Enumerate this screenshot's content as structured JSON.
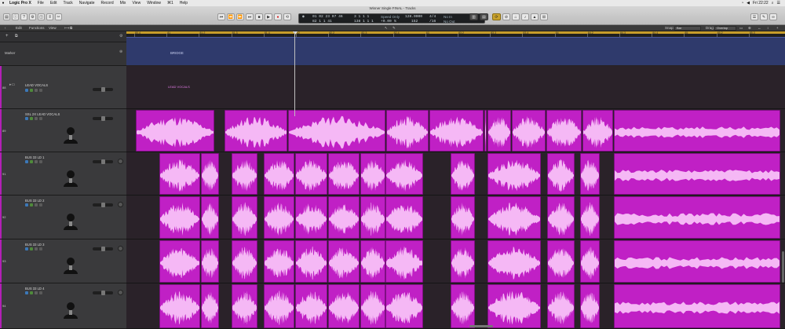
{
  "menubar": {
    "app": "Logic Pro X",
    "items": [
      "File",
      "Edit",
      "Track",
      "Navigate",
      "Record",
      "Mix",
      "View",
      "Window",
      "⌘1",
      "Help"
    ],
    "clock": "Fri 22:22"
  },
  "window": {
    "title": "Winner Single FINAL - Tracks"
  },
  "lcd": {
    "smpte": "01 02 23 07 46",
    "smpte2": "82 1 1 41",
    "bars": "3 1 1 1",
    "bars2": "138 1 1 1",
    "speed_label": "Speed Only",
    "speed_value": "+0.00",
    "speed_unit": "%",
    "tempo": "128.0000",
    "tempo_sub": "152",
    "timesig": "4/4",
    "division": "/16",
    "in_label": "No In",
    "out_label": "No Out"
  },
  "tracks_header": {
    "edit": "Edit",
    "functions": "Functions",
    "view": "View",
    "snap_label": "Snap:",
    "snap_value": "Bar",
    "drag_label": "Drag:",
    "drag_value": "Overlap"
  },
  "ruler": {
    "ticks": [
      "80.4",
      "81",
      "81.2",
      "81.3",
      "81.4",
      "82",
      "82.2",
      "82.3",
      "82.4",
      "83",
      "83.2",
      "83.3",
      "83.4",
      "84",
      "84.2",
      "84.3",
      "84.4",
      "85",
      "85.2",
      "85.3"
    ]
  },
  "marker": {
    "header": "Marker",
    "region_label": "BRIDGE"
  },
  "tracks": [
    {
      "num": "88",
      "name": "LEAD VOCALS",
      "region_label": "LEAD VOCALS"
    },
    {
      "num": "89",
      "name": "SSL 2X LEAD VOCALS"
    },
    {
      "num": "91",
      "name": "BUS 33 LD 1"
    },
    {
      "num": "92",
      "name": "BUS 33 LD 2"
    },
    {
      "num": "93",
      "name": "BUS 33 LD 3"
    },
    {
      "num": "94",
      "name": "BUS 33 LD 4"
    }
  ],
  "colors": {
    "region": "#c020c5",
    "region_border": "#7f0f83",
    "waveform": "#f5b8f5",
    "cycle": "#c79d2a",
    "marker": "#2f3a6c"
  },
  "icons": [
    "apple-icon",
    "library-icon",
    "inspector-icon",
    "help-icon",
    "rewind-icon",
    "forward-icon",
    "stop-icon",
    "play-icon",
    "record-icon",
    "cycle-icon",
    "metronome-icon",
    "editors-icon"
  ]
}
